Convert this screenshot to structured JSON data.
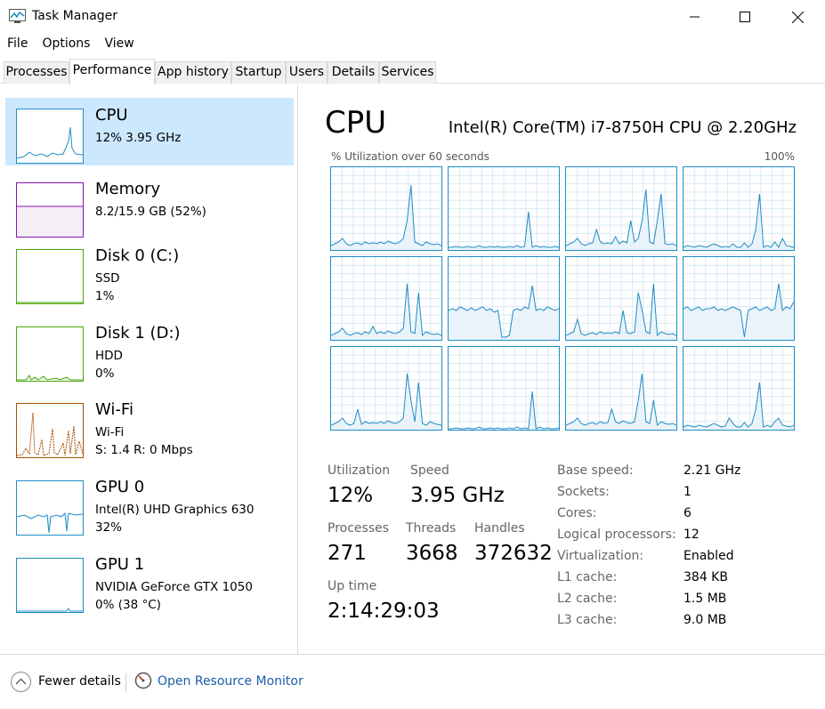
{
  "window": {
    "title": "Task Manager"
  },
  "menu": [
    "File",
    "Options",
    "View"
  ],
  "tabs": [
    "Processes",
    "Performance",
    "App history",
    "Startup",
    "Users",
    "Details",
    "Services"
  ],
  "active_tab": "Performance",
  "sidebar": {
    "items": [
      {
        "title": "CPU",
        "sub": [
          "12%  3.95 GHz"
        ],
        "color": "#1f8dc4",
        "selected": true
      },
      {
        "title": "Memory",
        "sub": [
          "8.2/15.9 GB (52%)"
        ],
        "color": "#8b12ae"
      },
      {
        "title": "Disk 0 (C:)",
        "sub": [
          "SSD",
          "1%"
        ],
        "color": "#4da60c"
      },
      {
        "title": "Disk 1 (D:)",
        "sub": [
          "HDD",
          "0%"
        ],
        "color": "#4da60c"
      },
      {
        "title": "Wi-Fi",
        "sub": [
          "Wi-Fi",
          "S: 1.4  R: 0 Mbps"
        ],
        "color": "#a74f01"
      },
      {
        "title": "GPU 0",
        "sub": [
          "Intel(R) UHD Graphics 630",
          "32%"
        ],
        "color": "#1f8dc4"
      },
      {
        "title": "GPU 1",
        "sub": [
          "NVIDIA GeForce GTX 1050",
          "0% (38 °C)"
        ],
        "color": "#1f8dc4"
      }
    ]
  },
  "main": {
    "title": "CPU",
    "model": "Intel(R) Core(TM) i7-8750H CPU @ 2.20GHz",
    "graph_label": "% Utilization over 60 seconds",
    "graph_max": "100%",
    "stats": {
      "utilization_label": "Utilization",
      "utilization": "12%",
      "speed_label": "Speed",
      "speed": "3.95 GHz",
      "processes_label": "Processes",
      "processes": "271",
      "threads_label": "Threads",
      "threads": "3668",
      "handles_label": "Handles",
      "handles": "372632",
      "uptime_label": "Up time",
      "uptime": "2:14:29:03"
    },
    "specs": [
      {
        "label": "Base speed:",
        "value": "2.21 GHz"
      },
      {
        "label": "Sockets:",
        "value": "1"
      },
      {
        "label": "Cores:",
        "value": "6"
      },
      {
        "label": "Logical processors:",
        "value": "12"
      },
      {
        "label": "Virtualization:",
        "value": "Enabled"
      },
      {
        "label": "L1 cache:",
        "value": "384 KB"
      },
      {
        "label": "L2 cache:",
        "value": "1.5 MB"
      },
      {
        "label": "L3 cache:",
        "value": "9.0 MB"
      }
    ]
  },
  "footer": {
    "fewer": "Fewer details",
    "monitor": "Open Resource Monitor"
  },
  "colors": {
    "cpu": "#1f8dc4",
    "memory": "#8b12ae",
    "disk": "#4da60c",
    "wifi": "#a74f01",
    "selected": "#cce8ff",
    "link": "#1a5ea8"
  }
}
